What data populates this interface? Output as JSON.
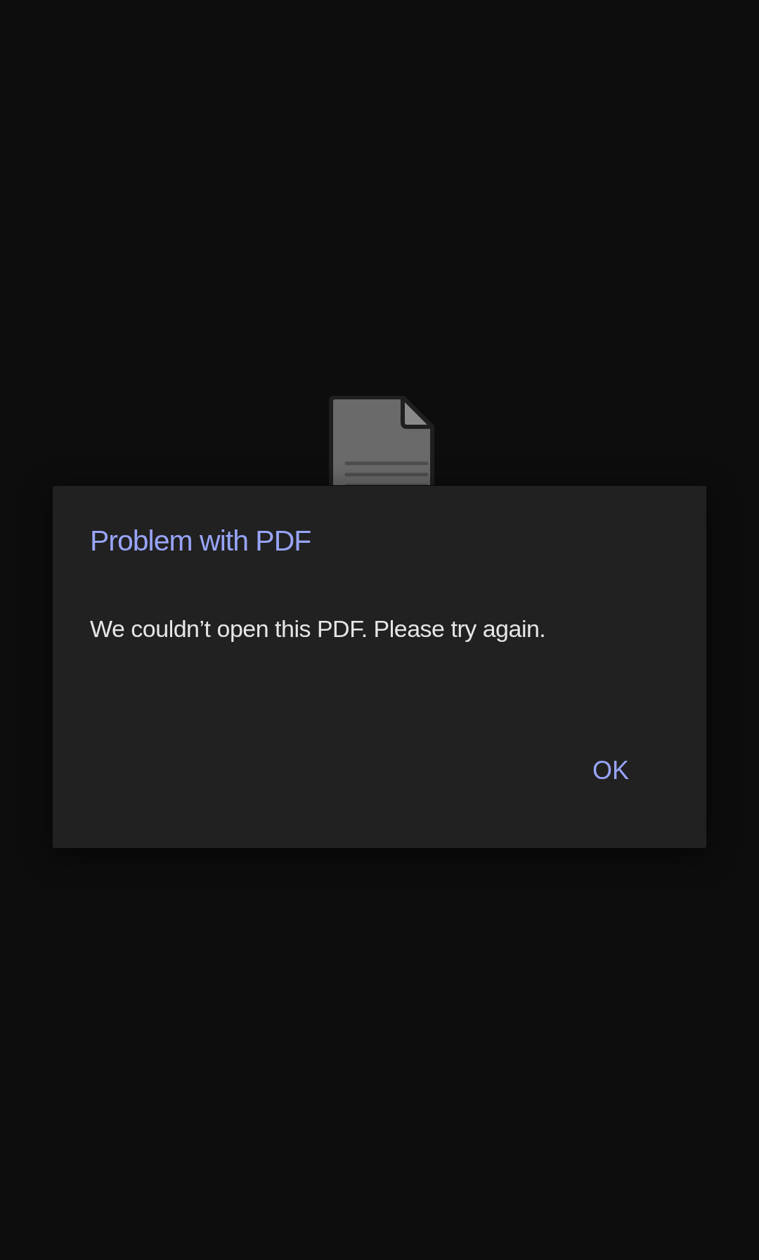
{
  "dialog": {
    "title": "Problem with PDF",
    "message": "We couldn’t open this PDF. Please try again.",
    "buttons": [
      "OK"
    ]
  }
}
